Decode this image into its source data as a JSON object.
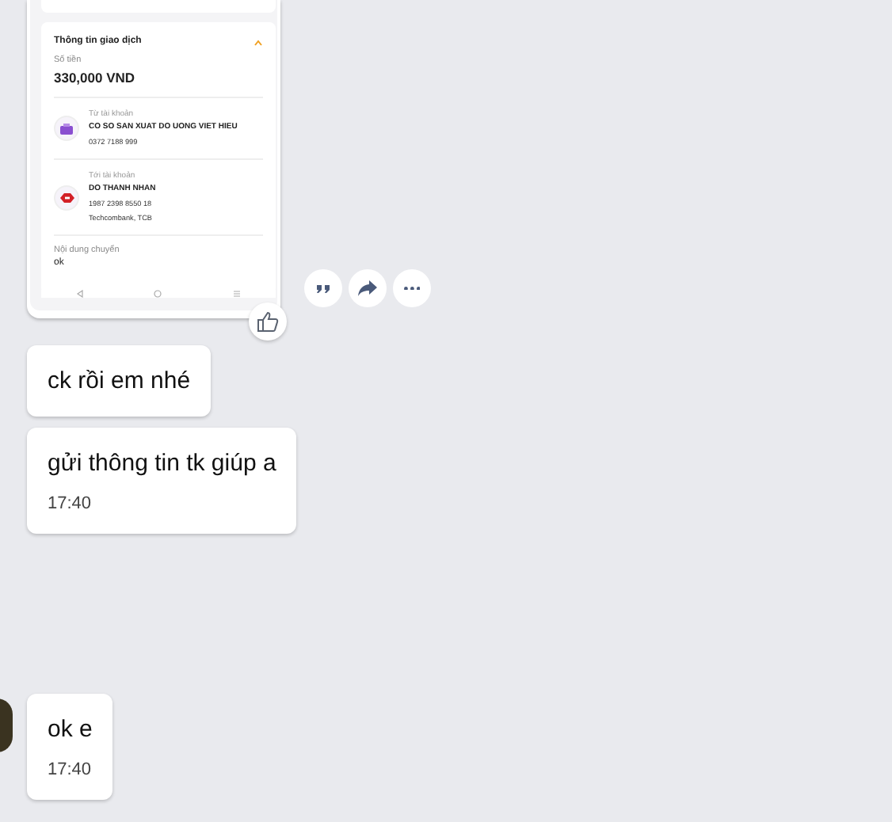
{
  "image_message": {
    "section_title": "Thông tin giao dịch",
    "amount_label": "Số tiền",
    "amount": "330,000 VND",
    "accounts": [
      {
        "label": "Từ tài khoản",
        "name": "CO SO SAN XUAT DO UONG VIET HIEU",
        "lines": [
          "0372 7188 999"
        ],
        "kind": "wallet"
      },
      {
        "label": "Tới tài khoản",
        "name": "DO THANH NHAN",
        "lines": [
          "1987 2398 8550 18",
          "Techcombank, TCB"
        ],
        "kind": "bank"
      }
    ],
    "note_label": "Nội dung chuyển",
    "note": "ok"
  },
  "messages": [
    {
      "text": "ck rồi em nhé"
    },
    {
      "text": "gửi thông tin tk giúp a",
      "time": "17:40"
    },
    {
      "text": "ok e",
      "time": "17:40",
      "avatar": true
    }
  ]
}
